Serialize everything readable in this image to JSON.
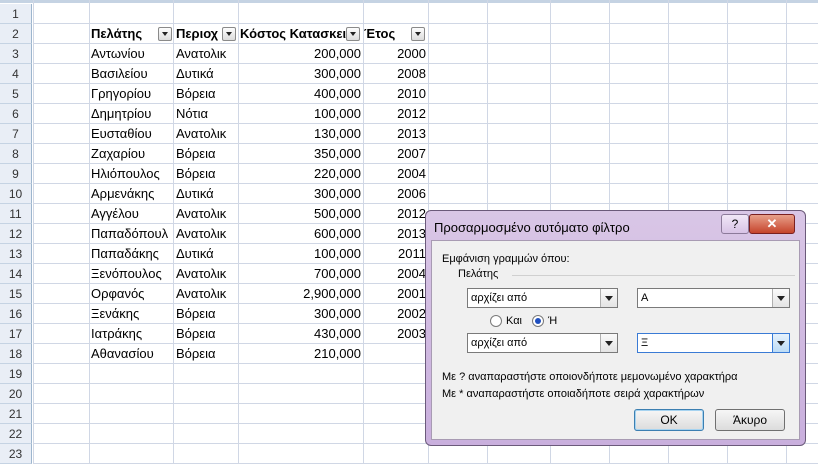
{
  "sheet": {
    "row_numbers": [
      "1",
      "2",
      "3",
      "4",
      "5",
      "6",
      "7",
      "8",
      "9",
      "10",
      "11",
      "12",
      "13",
      "14",
      "15",
      "16",
      "17",
      "18",
      "19",
      "20",
      "21",
      "22",
      "23"
    ],
    "headers": {
      "customer": "Πελάτης",
      "region": "Περιοχ",
      "cost": "Κόστος Κατασκει",
      "year": "Έτος"
    },
    "rows": [
      {
        "customer": "Αντωνίου",
        "region": "Ανατολικ",
        "cost": "200,000",
        "year": "2000"
      },
      {
        "customer": "Βασιλείου",
        "region": "Δυτικά",
        "cost": "300,000",
        "year": "2008"
      },
      {
        "customer": "Γρηγορίου",
        "region": "Βόρεια",
        "cost": "400,000",
        "year": "2010"
      },
      {
        "customer": "Δημητρίου",
        "region": "Νότια",
        "cost": "100,000",
        "year": "2012"
      },
      {
        "customer": "Ευσταθίου",
        "region": "Ανατολικ",
        "cost": "130,000",
        "year": "2013"
      },
      {
        "customer": "Ζαχαρίου",
        "region": "Βόρεια",
        "cost": "350,000",
        "year": "2007"
      },
      {
        "customer": "Ηλιόπουλος",
        "region": "Βόρεια",
        "cost": "220,000",
        "year": "2004"
      },
      {
        "customer": "Αρμενάκης",
        "region": "Δυτικά",
        "cost": "300,000",
        "year": "2006"
      },
      {
        "customer": "Αγγέλου",
        "region": "Ανατολικ",
        "cost": "500,000",
        "year": "2012"
      },
      {
        "customer": "Παπαδόπουλ",
        "region": "Ανατολικ",
        "cost": "600,000",
        "year": "2013"
      },
      {
        "customer": "Παπαδάκης",
        "region": "Δυτικά",
        "cost": "100,000",
        "year": "2011"
      },
      {
        "customer": "Ξενόπουλος",
        "region": "Ανατολικ",
        "cost": "700,000",
        "year": "2004"
      },
      {
        "customer": "Ορφανός",
        "region": "Ανατολικ",
        "cost": "2,900,000",
        "year": "2001"
      },
      {
        "customer": "Ξενάκης",
        "region": "Βόρεια",
        "cost": "300,000",
        "year": "2002"
      },
      {
        "customer": "Ιατράκης",
        "region": "Βόρεια",
        "cost": "430,000",
        "year": "2003"
      },
      {
        "customer": "Αθανασίου",
        "region": "Βόρεια",
        "cost": "210,000",
        "year": ""
      }
    ]
  },
  "dialog": {
    "title": "Προσαρμοσμένο αυτόματο φίλτρο",
    "help": "?",
    "close": "✕",
    "show_rows_label": "Εμφάνιση γραμμών όπου:",
    "field_label": "Πελάτης",
    "condition1": {
      "operator": "αρχίζει από",
      "value": "Α"
    },
    "and_label": "Και",
    "or_label": "Ή",
    "selected_logic": "or",
    "condition2": {
      "operator": "αρχίζει από",
      "value": "Ξ"
    },
    "hint1": "Με ? αναπαραστήστε οποιονδήποτε μεμονωμένο χαρακτήρα",
    "hint2": "Με * αναπαραστήστε οποιαδήποτε σειρά χαρακτήρων",
    "ok": "OK",
    "cancel": "Άκυρο"
  }
}
